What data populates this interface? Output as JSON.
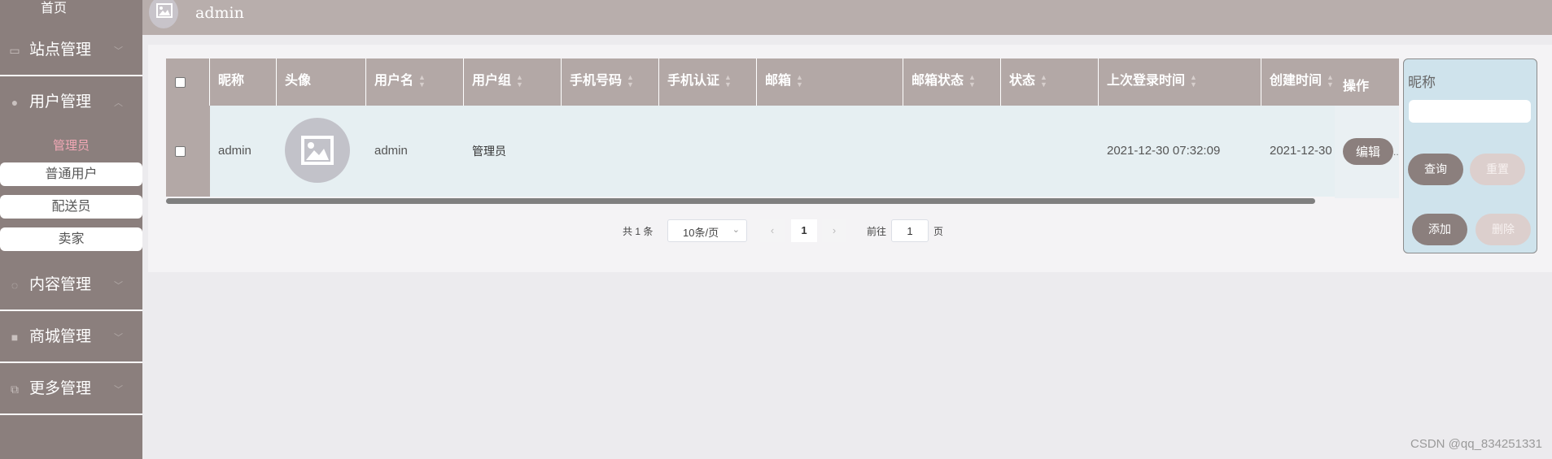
{
  "sidebar": {
    "home": "首页",
    "groups": [
      {
        "label": "站点管理",
        "icon": "monitor-icon"
      },
      {
        "label": "用户管理",
        "icon": "user-icon"
      },
      {
        "label": "内容管理",
        "icon": "chat-icon"
      },
      {
        "label": "商城管理",
        "icon": "bag-icon"
      },
      {
        "label": "更多管理",
        "icon": "copy-icon"
      }
    ],
    "user_sub": {
      "active": "管理员",
      "items": [
        "普通用户",
        "配送员",
        "卖家"
      ]
    }
  },
  "header": {
    "title": "admin"
  },
  "table": {
    "columns": [
      "昵称",
      "头像",
      "用户名",
      "用户组",
      "手机号码",
      "手机认证",
      "邮箱",
      "邮箱状态",
      "状态",
      "上次登录时间",
      "创建时间",
      "操作"
    ],
    "rows": [
      {
        "nickname": "admin",
        "username": "admin",
        "group": "管理员",
        "phone": "",
        "phone_auth": "",
        "email": "",
        "email_status": "",
        "status": "",
        "last_login": "2021-12-30 07:32:09",
        "created": "2021-12-30",
        "edit_label": "编辑"
      }
    ]
  },
  "pagination": {
    "total": "共 1 条",
    "page_size": "10条/页",
    "prev": "‹",
    "current": "1",
    "next": "›",
    "goto_label": "前往",
    "goto_value": "1",
    "page_label": "页"
  },
  "search": {
    "label": "昵称",
    "placeholder": "",
    "query": "查询",
    "reset": "重置",
    "add": "添加",
    "delete": "删除"
  },
  "watermark": "CSDN @qq_834251331",
  "colors": {
    "sidebar": "#8b7f7d",
    "header": "#b8aeac",
    "accent_pink": "#f2a8b6",
    "search_panel": "#cfe3ec"
  }
}
